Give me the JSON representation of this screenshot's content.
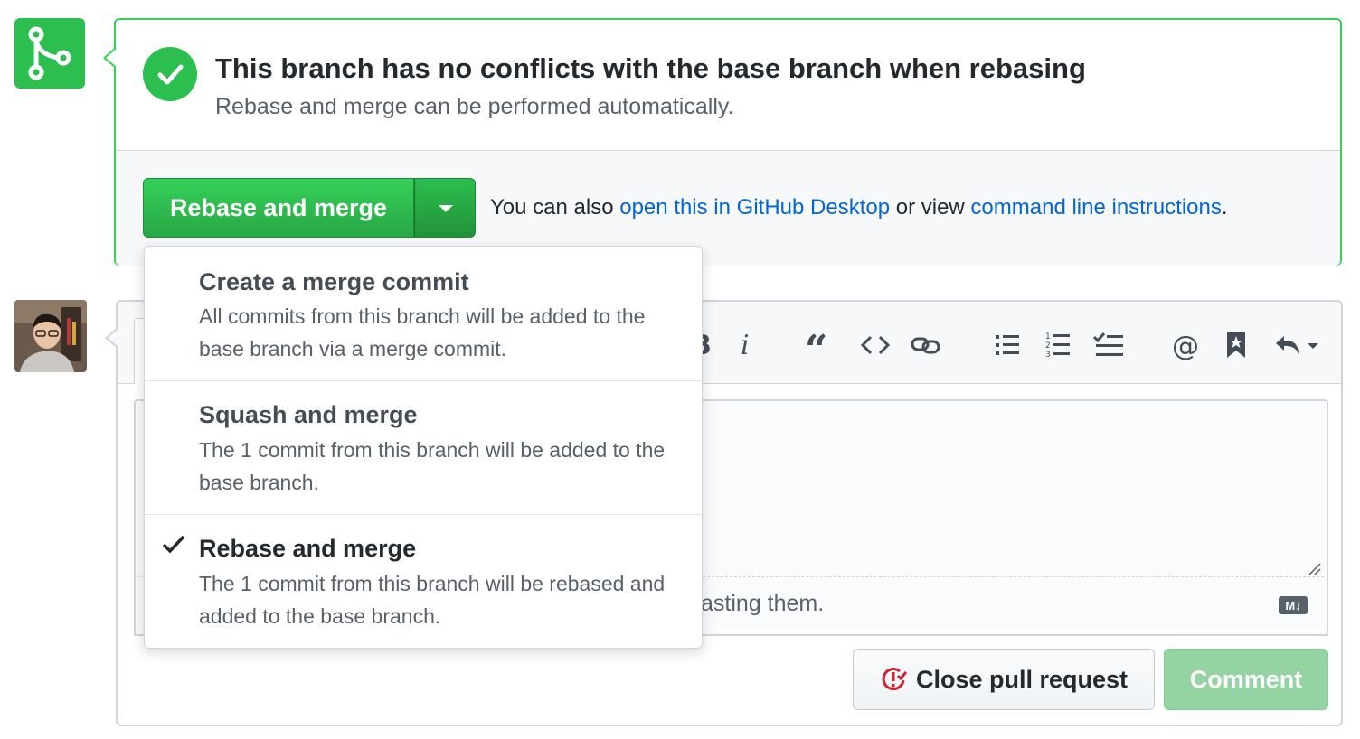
{
  "colors": {
    "success": "#2cbe4e",
    "link": "#0366d6",
    "text": "#24292e",
    "muted": "#586069",
    "danger": "#cb2431",
    "comment_disabled": "#94d3a2"
  },
  "merge_status": {
    "icon": "git-merge-icon",
    "title": "This branch has no conflicts with the base branch when rebasing",
    "subtitle": "Rebase and merge can be performed automatically."
  },
  "merge_action": {
    "button_label": "Rebase and merge",
    "also_prefix": "You can also ",
    "desktop_link": "open this in GitHub Desktop",
    "middle": " or view ",
    "cli_link": "command line instructions",
    "suffix": "."
  },
  "merge_menu": {
    "items": [
      {
        "title": "Create a merge commit",
        "description": "All commits from this branch will be added to the base branch via a merge commit.",
        "selected": false
      },
      {
        "title": "Squash and merge",
        "description": "The 1 commit from this branch will be added to the base branch.",
        "selected": false
      },
      {
        "title": "Rebase and merge",
        "description": "The 1 commit from this branch will be rebased and added to the base branch.",
        "selected": true
      }
    ]
  },
  "comment": {
    "toolbar": [
      "bold-icon",
      "italic-icon",
      "quote-icon",
      "code-icon",
      "link-icon",
      "unordered-list-icon",
      "ordered-list-icon",
      "task-list-icon",
      "mention-icon",
      "saved-reply-icon",
      "reply-icon"
    ],
    "drag_hint_visible": "asting them.",
    "markdown_badge": "M↓",
    "close_button": "Close pull request",
    "comment_button": "Comment"
  }
}
